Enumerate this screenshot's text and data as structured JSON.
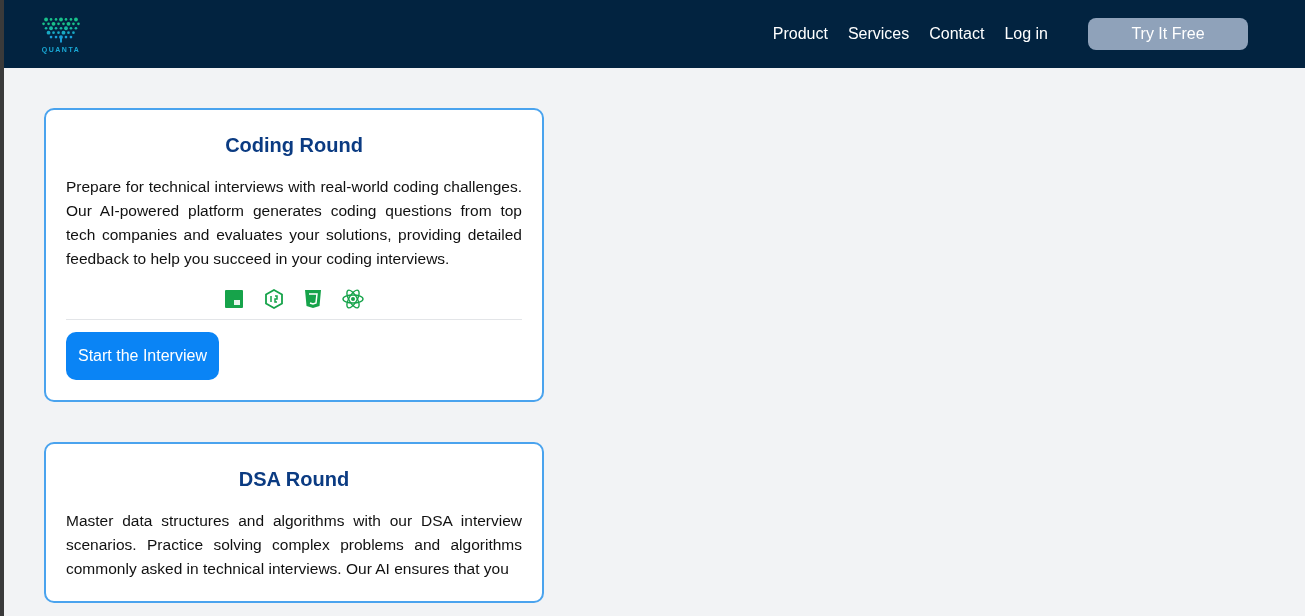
{
  "header": {
    "logo_text": "QUANTA",
    "nav": [
      {
        "label": "Product"
      },
      {
        "label": "Services"
      },
      {
        "label": "Contact"
      },
      {
        "label": "Log in"
      }
    ],
    "cta": "Try It Free"
  },
  "cards": [
    {
      "title": "Coding Round",
      "description": "Prepare for technical interviews with real-world coding challenges. Our AI-powered platform generates coding questions from top tech companies and evaluates your solutions, providing detailed feedback to help you succeed in your coding interviews.",
      "icons": [
        {
          "kind": "square"
        },
        {
          "kind": "hexagon"
        },
        {
          "kind": "shield"
        },
        {
          "kind": "atom"
        }
      ],
      "button": "Start the Interview"
    },
    {
      "title": "DSA Round",
      "description": "Master data structures and algorithms with our DSA interview scenarios. Practice solving complex problems and algorithms commonly asked in technical interviews. Our AI ensures that you"
    }
  ]
}
